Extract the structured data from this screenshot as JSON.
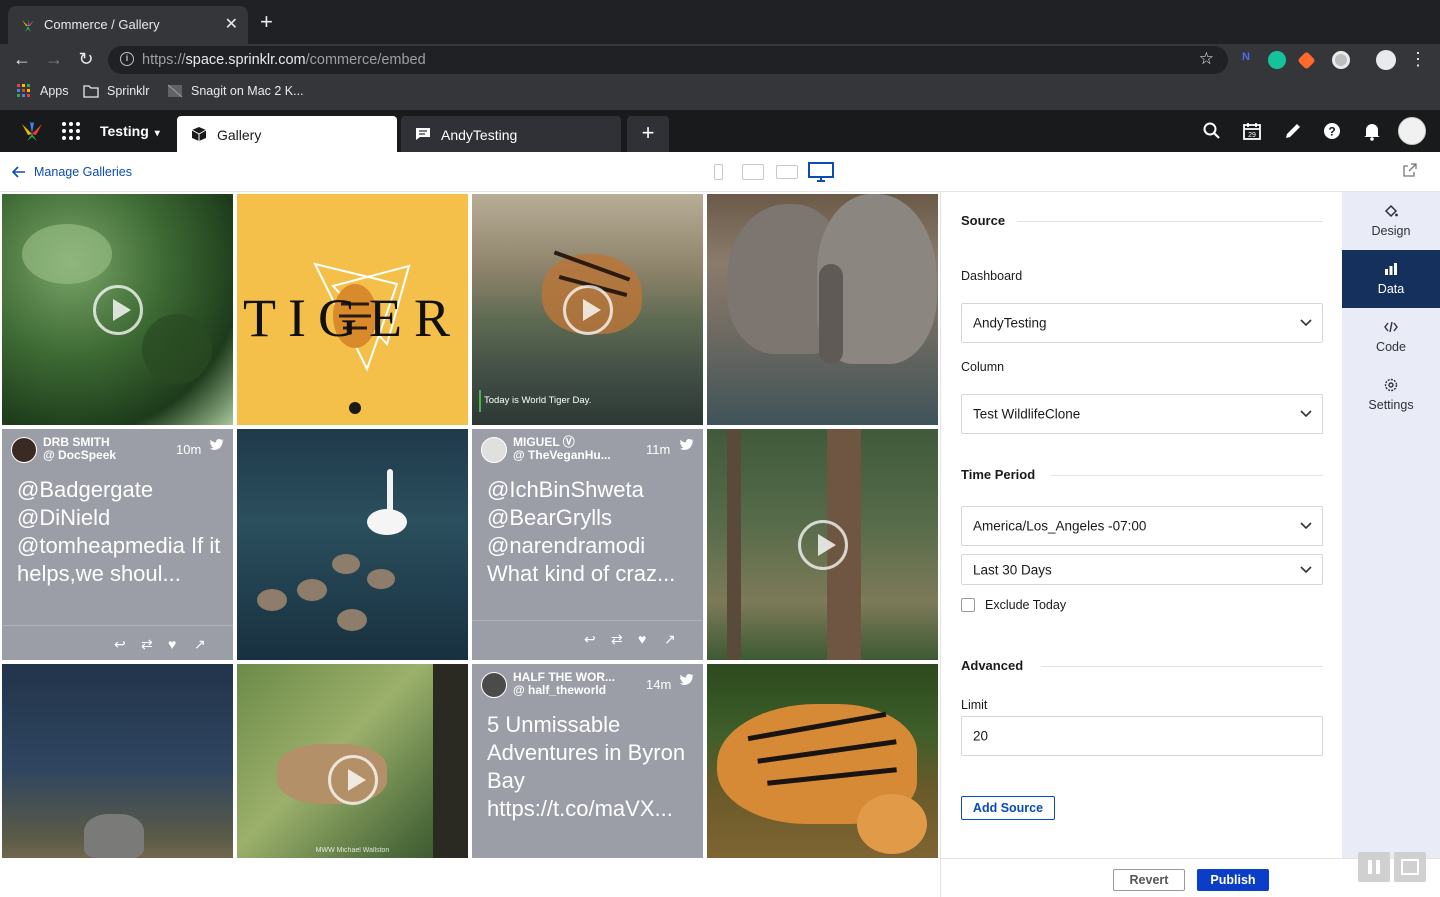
{
  "browser": {
    "tab_title": "Commerce / Gallery",
    "url_prefix": "https://",
    "url_domain": "space.sprinklr.com",
    "url_path": "/commerce/embed",
    "bookmarks": [
      "Apps",
      "Sprinklr",
      "Snagit on Mac 2 K..."
    ]
  },
  "app": {
    "workspace": "Testing",
    "tabs": [
      {
        "label": "Gallery"
      },
      {
        "label": "AndyTesting"
      }
    ]
  },
  "subheader": {
    "back_label": "Manage Galleries"
  },
  "gallery": {
    "tiles": [
      {
        "type": "video",
        "caption": ""
      },
      {
        "type": "image",
        "caption": "TIGER"
      },
      {
        "type": "video",
        "caption": "Today is World Tiger Day."
      },
      {
        "type": "image",
        "caption": ""
      },
      {
        "type": "tweet",
        "name": "DRB SMITH",
        "handle": "@ DocSpeek",
        "time": "10m",
        "text": "@Badgergate @DiNield @tomheapmedia If it helps,we shoul..."
      },
      {
        "type": "image",
        "caption": ""
      },
      {
        "type": "tweet",
        "name": "MIGUEL Ⓥ",
        "handle": "@ TheVeganHu...",
        "time": "11m",
        "text": "@IchBinShweta @BearGrylls @narendramodi What kind of craz..."
      },
      {
        "type": "video",
        "caption": ""
      },
      {
        "type": "image",
        "caption": ""
      },
      {
        "type": "video",
        "caption": "MWW Michael Wallston"
      },
      {
        "type": "tweet",
        "name": "HALF THE WOR...",
        "handle": "@ half_theworld",
        "time": "14m",
        "text": "5 Unmissable Adventures in Byron Bay https://t.co/maVX..."
      },
      {
        "type": "image",
        "caption": ""
      }
    ]
  },
  "panel": {
    "source_heading": "Source",
    "dashboard_label": "Dashboard",
    "dashboard_value": "AndyTesting",
    "column_label": "Column",
    "column_value": "Test WildlifeClone",
    "time_heading": "Time Period",
    "timezone_value": "America/Los_Angeles -07:00",
    "range_value": "Last 30 Days",
    "exclude_today_label": "Exclude Today",
    "exclude_today_checked": false,
    "advanced_heading": "Advanced",
    "limit_label": "Limit",
    "limit_value": "20",
    "add_source_label": "Add Source"
  },
  "sidenav": {
    "items": [
      {
        "label": "Design",
        "icon": "paint-bucket-icon"
      },
      {
        "label": "Data",
        "icon": "bar-chart-icon"
      },
      {
        "label": "Code",
        "icon": "code-icon"
      },
      {
        "label": "Settings",
        "icon": "gear-icon"
      }
    ],
    "active": "Data"
  },
  "footer": {
    "revert_label": "Revert",
    "publish_label": "Publish"
  },
  "colors": {
    "accent": "#0b4bb5",
    "publish": "#0b3ec8",
    "sidenav_active": "#16305e",
    "tweet_bg": "#9b9ea6"
  }
}
